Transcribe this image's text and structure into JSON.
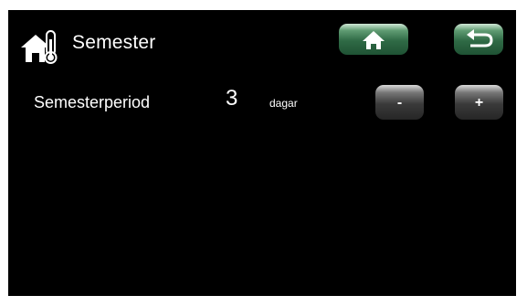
{
  "header": {
    "title": "Semester",
    "icon": "house-thermometer-icon"
  },
  "toolbar": {
    "home_icon": "home-icon",
    "back_icon": "back-arrow-icon"
  },
  "setting": {
    "label": "Semesterperiod",
    "value": "3",
    "unit": "dagar",
    "decrease_label": "-",
    "increase_label": "+"
  },
  "colors": {
    "background": "#000000",
    "text": "#ffffff",
    "button_green": "#2f6a45",
    "button_grey": "#3a3a3a"
  }
}
